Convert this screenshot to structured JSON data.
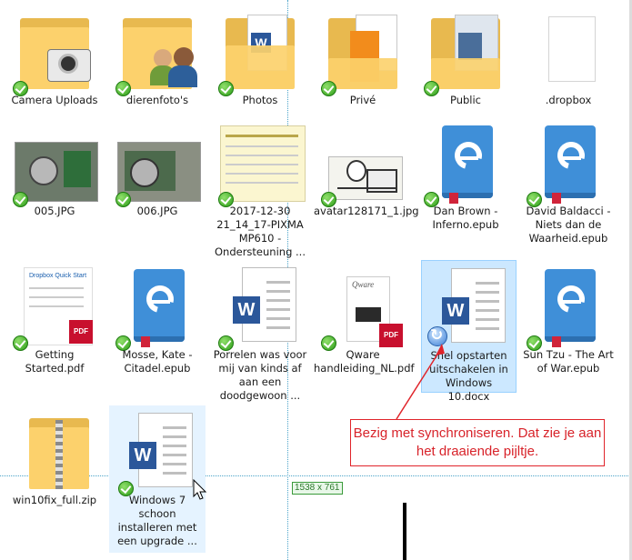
{
  "files": [
    {
      "name": "Camera Uploads",
      "type": "folder-camera"
    },
    {
      "name": "dierenfoto's",
      "type": "folder-people"
    },
    {
      "name": "Photos",
      "type": "folder-doc"
    },
    {
      "name": "Privé",
      "type": "folder-orange"
    },
    {
      "name": "Public",
      "type": "folder-screens"
    },
    {
      "name": ".dropbox",
      "type": "blank"
    },
    {
      "name": "005.JPG",
      "type": "photo"
    },
    {
      "name": "006.JPG",
      "type": "photo"
    },
    {
      "name": "2017-12-30 21_14_17-PIXMA MP610 - Ondersteuning ...",
      "type": "screenshot"
    },
    {
      "name": "avatar128171_1.jpg",
      "type": "cartoon"
    },
    {
      "name": "Dan Brown - Inferno.epub",
      "type": "epub"
    },
    {
      "name": "David Baldacci - Niets dan de Waarheid.epub",
      "type": "epub"
    },
    {
      "name": "Getting Started.pdf",
      "type": "pdf"
    },
    {
      "name": "Mosse, Kate - Citadel.epub",
      "type": "epub"
    },
    {
      "name": "Porrelen was voor mij van kinds af aan een doodgewoon ...",
      "type": "word"
    },
    {
      "name": "Qware handleiding_NL.pdf",
      "type": "pdf"
    },
    {
      "name": "Snel opstarten uitschakelen in Windows 10.docx",
      "type": "word",
      "status": "syncing"
    },
    {
      "name": "Sun Tzu - The Art of War.epub",
      "type": "epub"
    },
    {
      "name": "win10fix_full.zip",
      "type": "zip"
    },
    {
      "name": "Windows 7 schoon installeren met een upgrade ...",
      "type": "word"
    }
  ],
  "annotation": {
    "text": "Bezig met synchroniseren. Dat zie je aan het draaiende pijltje.",
    "color": "#d8232a"
  },
  "overlay": {
    "dimensions": "1538 x 761"
  },
  "thumb_text": {
    "dropbox_guide": "Dropbox Quick Start",
    "qware_brand": "Qware",
    "word_letter": "W",
    "pdf_label": "PDF"
  },
  "colors": {
    "sync_ok": "#2f9e1a",
    "selection": "#cce8ff",
    "folder": "#fcd16c",
    "word": "#2b579a",
    "epub": "#3f8fd8"
  }
}
